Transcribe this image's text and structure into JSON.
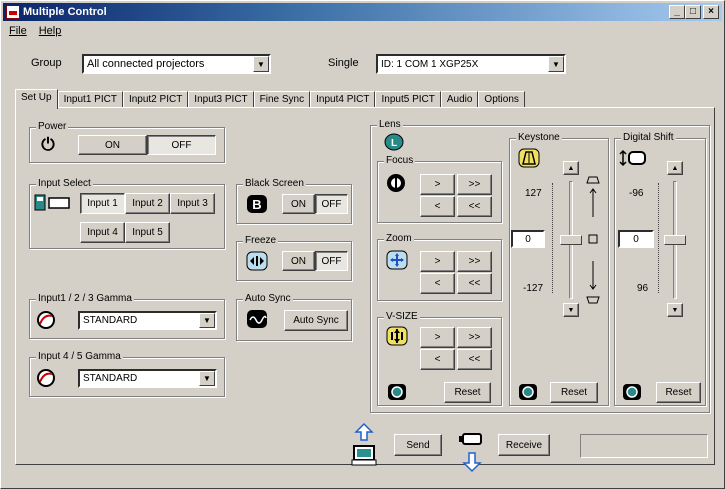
{
  "window": {
    "title": "Multiple Control",
    "min": "_",
    "max": "□",
    "close": "×"
  },
  "menu": {
    "file": "File",
    "help": "Help"
  },
  "group": {
    "label": "Group",
    "value": "All connected projectors"
  },
  "single": {
    "label": "Single",
    "value": "ID: 1  COM 1  XGP25X"
  },
  "tabs": [
    "Set Up",
    "Input1 PICT",
    "Input2 PICT",
    "Input3 PICT",
    "Fine Sync",
    "Input4 PICT",
    "Input5 PICT",
    "Audio",
    "Options"
  ],
  "power": {
    "title": "Power",
    "on": "ON",
    "off": "OFF",
    "selected": "OFF"
  },
  "input_select": {
    "title": "Input Select",
    "buttons": [
      "Input 1",
      "Input 2",
      "Input 3",
      "Input 4",
      "Input 5"
    ],
    "selected": "Input 1"
  },
  "black_screen": {
    "title": "Black Screen",
    "on": "ON",
    "off": "OFF",
    "selected": "OFF"
  },
  "freeze": {
    "title": "Freeze",
    "on": "ON",
    "off": "OFF",
    "selected": "OFF"
  },
  "auto_sync": {
    "title": "Auto Sync",
    "button": "Auto Sync"
  },
  "gamma123": {
    "title": "Input1 / 2 / 3 Gamma",
    "value": "STANDARD"
  },
  "gamma45": {
    "title": "Input 4 / 5 Gamma",
    "value": "STANDARD"
  },
  "lens": {
    "title": "Lens",
    "focus": {
      "title": "Focus",
      "b1": ">",
      "b2": ">>",
      "b3": "<",
      "b4": "<<"
    },
    "zoom": {
      "title": "Zoom",
      "b1": ">",
      "b2": ">>",
      "b3": "<",
      "b4": "<<"
    },
    "vsize": {
      "title": "V-SIZE",
      "b1": ">",
      "b2": ">>",
      "b3": "<",
      "b4": "<<",
      "reset": "Reset"
    }
  },
  "keystone": {
    "title": "Keystone",
    "max": "127",
    "value": "0",
    "min": "-127",
    "reset": "Reset",
    "level": 0.5
  },
  "digital_shift": {
    "title": "Digital Shift",
    "max": "-96",
    "value": "0",
    "min": "96",
    "reset": "Reset",
    "level": 0.5
  },
  "footer": {
    "send": "Send",
    "receive": "Receive"
  }
}
